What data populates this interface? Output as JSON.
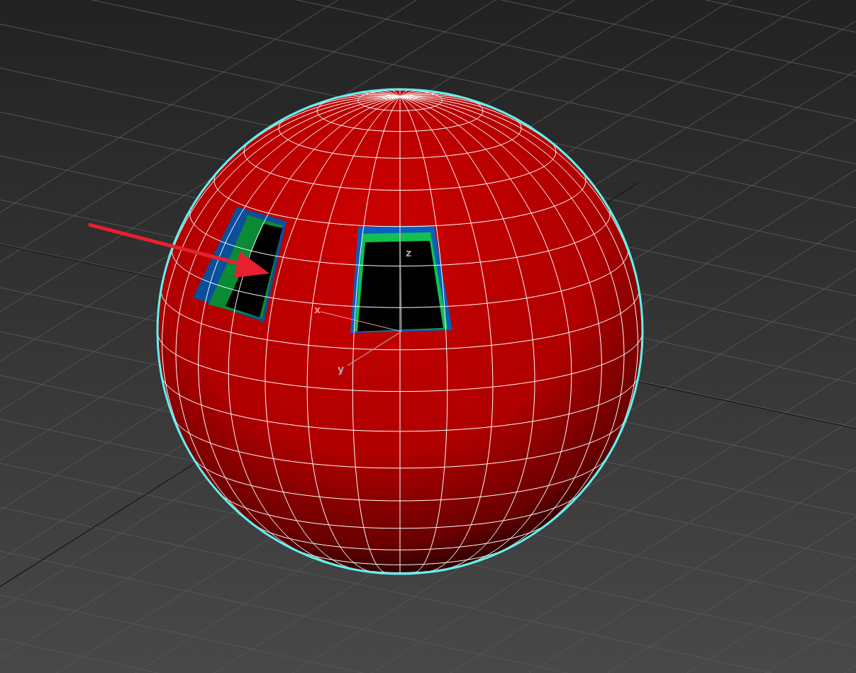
{
  "viewport": {
    "axis_labels": [
      {
        "label": "z",
        "kind": "z",
        "color": "#a0a0a0"
      },
      {
        "label": "x",
        "kind": "x",
        "color": "#ff9090"
      },
      {
        "label": "y",
        "kind": "y",
        "color": "#a8a8a8"
      }
    ]
  }
}
